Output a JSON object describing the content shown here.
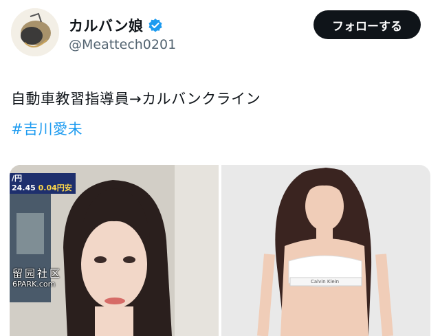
{
  "profile": {
    "display_name": "カルバン娘",
    "handle": "@Meattech0201",
    "follow_label": "フォローする"
  },
  "tweet": {
    "text": "自動車教習指導員→カルバンクライン",
    "hashtag": "#吉川愛未"
  },
  "media": {
    "left_photo": {
      "ticker_line1": "/円",
      "ticker_value": "24.45",
      "ticker_rate": "0.04円安",
      "watermark_line1": "留园社区",
      "watermark_line2": "6PARK.com"
    },
    "right_photo": {
      "band_brand": "Calvin Klein"
    }
  },
  "colors": {
    "accent": "#1d9bf0",
    "button_bg": "#0f1419",
    "secondary_text": "#536471"
  }
}
